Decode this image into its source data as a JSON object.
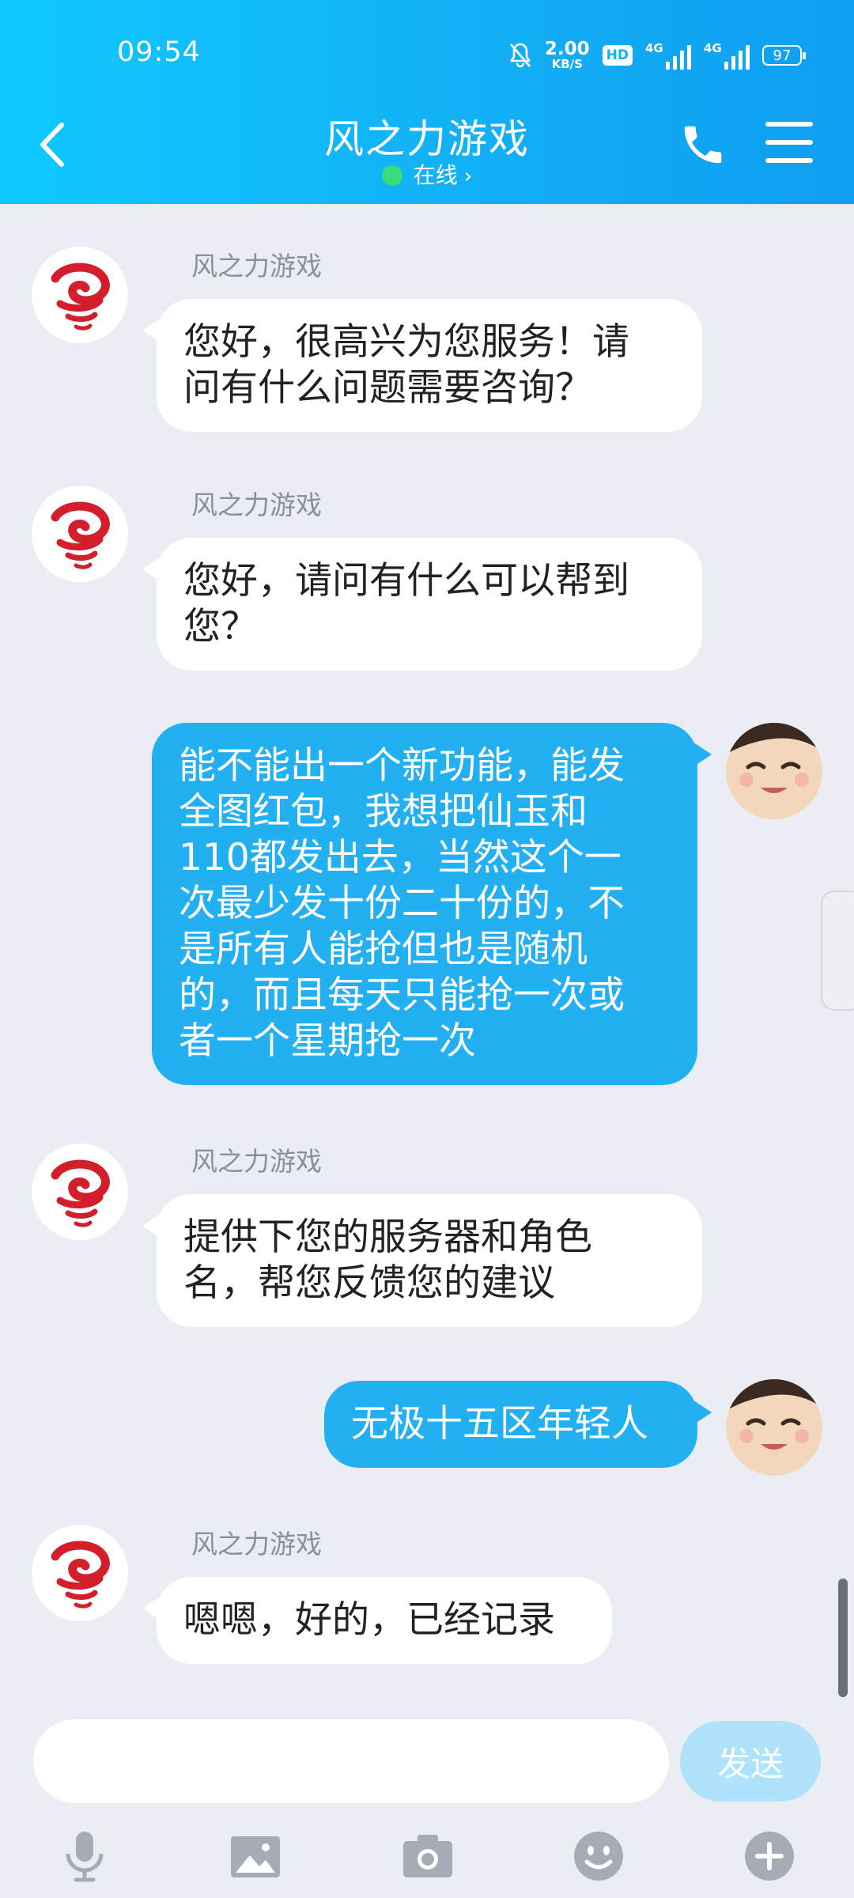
{
  "status_bar": {
    "time": "09:54",
    "net_speed_value": "2.00",
    "net_speed_unit": "KB/S",
    "hd_label": "HD",
    "signal1_label": "4G",
    "signal2_label": "4G",
    "battery": "97"
  },
  "header": {
    "title": "风之力游戏",
    "status": "在线",
    "status_chevron": "›"
  },
  "messages": [
    {
      "from": "bot",
      "sender": "风之力游戏",
      "text": "您好，很高兴为您服务！请\n问有什么问题需要咨询？"
    },
    {
      "from": "bot",
      "sender": "风之力游戏",
      "text": "您好，请问有什么可以帮到\n您？"
    },
    {
      "from": "me",
      "text": "能不能出一个新功能，能发\n全图红包，我想把仙玉和\n110都发出去，当然这个一\n次最少发十份二十份的，不\n是所有人能抢但也是随机\n的，而且每天只能抢一次或\n者一个星期抢一次"
    },
    {
      "from": "bot",
      "sender": "风之力游戏",
      "text": "提供下您的服务器和角色\n名，帮您反馈您的建议"
    },
    {
      "from": "me",
      "text": "无极十五区年轻人"
    },
    {
      "from": "bot",
      "sender": "风之力游戏",
      "text": "嗯嗯，好的，已经记录"
    }
  ],
  "composer": {
    "input_value": "",
    "send_label": "发送"
  },
  "toolbar": {
    "icons": [
      "microphone-icon",
      "image-icon",
      "camera-icon",
      "emoji-icon",
      "plus-icon"
    ]
  },
  "colors": {
    "header_gradient_start": "#10c8ff",
    "header_gradient_end": "#0f9ef0",
    "outgoing_bubble": "#23b0f3",
    "incoming_bubble": "#ffffff",
    "background": "#ebedf5",
    "send_button": "#aee3fb",
    "online_dot": "#3bd977"
  }
}
